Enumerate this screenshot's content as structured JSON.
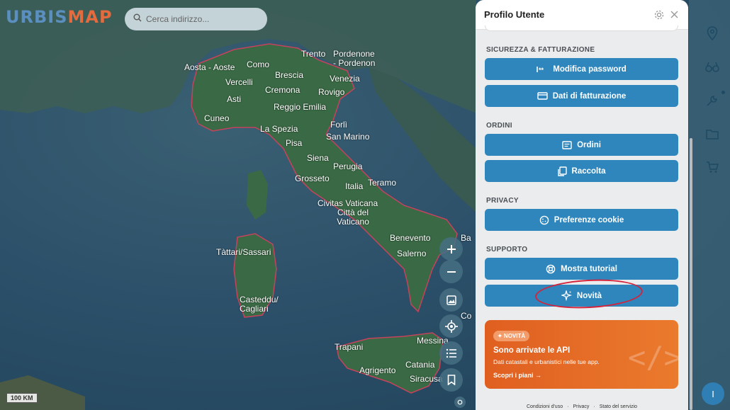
{
  "app": {
    "logo_part1": "URBIS",
    "logo_part2": "MAP"
  },
  "search": {
    "placeholder": "Cerca indirizzo..."
  },
  "map": {
    "scale_label": "100 KM",
    "cities": [
      "Aosta - Aoste",
      "Como",
      "Trento",
      "Pordenone - Pordenon",
      "Brescia",
      "Venezia",
      "Vercelli",
      "Cremona",
      "Asti",
      "Rovigo",
      "Reggio Emilia",
      "Cuneo",
      "Forlì",
      "La Spezia",
      "San Marino",
      "Pisa",
      "Siena",
      "Perugia",
      "Grosseto",
      "Italia",
      "Teramo",
      "Civitas Vaticana",
      "Città del Vaticano",
      "Benevento",
      "Salerno",
      "Tàttari/Sassari",
      "Casteddu/ Cagliari",
      "Messina",
      "Trapani",
      "Catania",
      "Agrigento",
      "Siracusa",
      "Ba",
      "Co"
    ]
  },
  "panel": {
    "title": "Profilo Utente",
    "sections": {
      "security": "SICUREZZA & FATTURAZIONE",
      "orders": "ORDINI",
      "privacy": "PRIVACY",
      "support": "SUPPORTO"
    },
    "buttons": {
      "change_password": "Modifica password",
      "billing": "Dati di fatturazione",
      "orders": "Ordini",
      "collection": "Raccolta",
      "cookies": "Preferenze cookie",
      "tutorial": "Mostra tutorial",
      "news": "Novità"
    },
    "promo": {
      "badge": "✦ NOVITÀ",
      "title": "Sono arrivate le API",
      "subtitle": "Dati catastali e urbanistici nelle tue app.",
      "link": "Scopri i piani →",
      "deco": "</>"
    },
    "footer": {
      "terms": "Condizioni d'uso",
      "sep1": "·",
      "privacy": "Privacy",
      "sep2": "·",
      "status": "Stato del servizio"
    }
  },
  "user": {
    "avatar_initial": "I"
  },
  "colors": {
    "primary": "#2e86bd",
    "promo": "#e8702a",
    "annotation": "#d4233a"
  }
}
